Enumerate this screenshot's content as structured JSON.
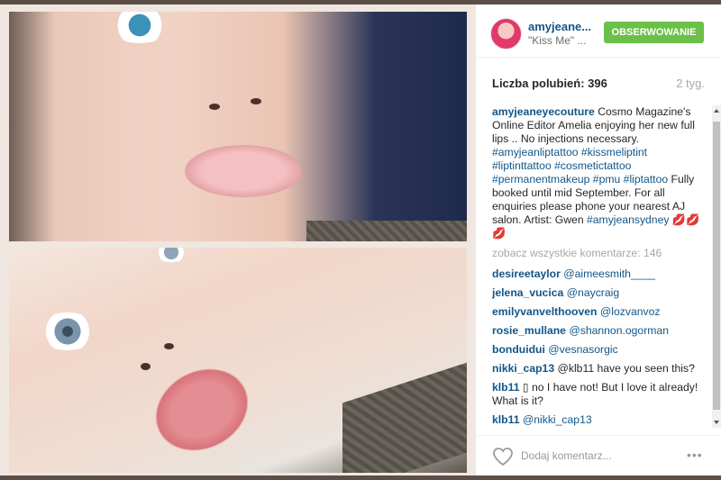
{
  "header": {
    "username": "amyjeane...",
    "location": "\"Kiss Me\" ...",
    "follow_label": "OBSERWOWANIE"
  },
  "post": {
    "likes": "Liczba polubień: 396",
    "time": "2 tyg."
  },
  "caption": {
    "user": "amyjeaneyecouture",
    "text1": " Cosmo Magazine's Online Editor Amelia enjoying her new full lips .. No injections necessary. ",
    "tags1": "#amyjeanliptattoo #kissmeliptint #liptinttattoo #cosmetictattoo #permanentmakeup #pmu #liptattoo",
    "text2": " Fully booked until mid September. For all enquiries please phone your nearest AJ salon. Artist: Gwen ",
    "tags2": "#amyjeansydney",
    "emoji": "💋💋💋"
  },
  "view_all": "zobacz wszystkie komentarze: 146",
  "comments": [
    {
      "user": "desireetaylor",
      "text": " @aimeesmith____"
    },
    {
      "user": "jelena_vucica",
      "text": " @naycraig"
    },
    {
      "user": "emilyvanvelthooven",
      "text": " @lozvanvoz"
    },
    {
      "user": "rosie_mullane",
      "text": " @shannon.ogorman"
    },
    {
      "user": "bonduidui",
      "text": " @vesnasorgic"
    },
    {
      "user": "nikki_cap13",
      "text": " @klb11 have you seen this?"
    },
    {
      "user": "klb11",
      "text": " ▯ no I have not! But I love it already! What is it?"
    },
    {
      "user": "klb11",
      "text": " @nikki_cap13"
    }
  ],
  "footer": {
    "add_comment": "Dodaj komentarz...",
    "more": "•••"
  },
  "colors": {
    "link": "#125688",
    "follow": "#6cc04a",
    "muted": "#a5a7aa"
  }
}
